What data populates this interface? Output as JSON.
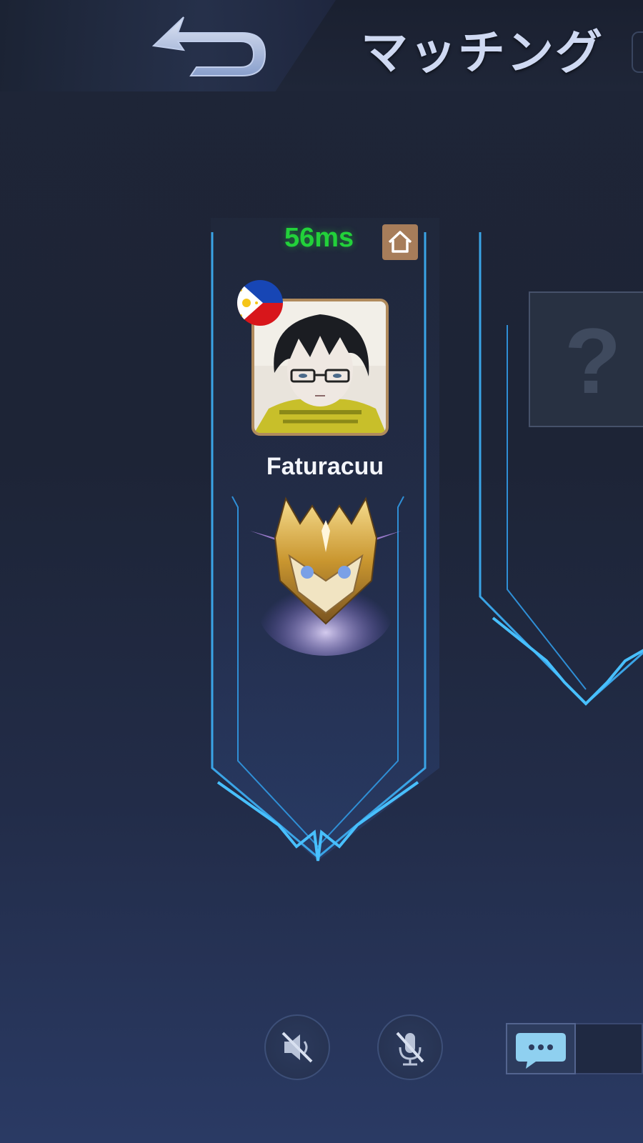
{
  "header": {
    "title": "マッチング",
    "back_icon": "back-arrow-icon"
  },
  "player": {
    "ping": "56ms",
    "ping_color": "#22d13a",
    "name": "Faturacuu",
    "flag": "philippines-flag-icon",
    "home_icon": "home-icon",
    "rank_emblem": "rank-emblem-icon"
  },
  "second_slot": {
    "placeholder": "?"
  },
  "controls": {
    "speaker_icon": "speaker-muted-icon",
    "mic_icon": "mic-muted-icon",
    "chat_icon": "chat-bubble-icon"
  }
}
